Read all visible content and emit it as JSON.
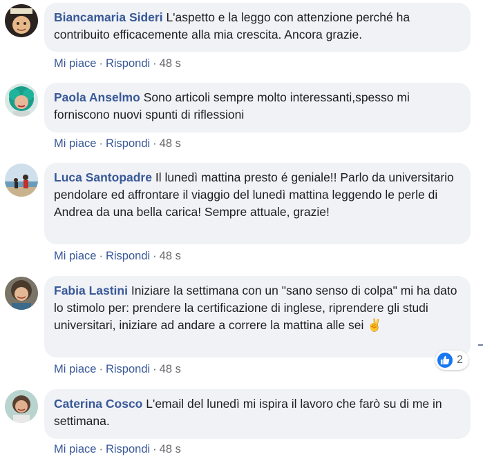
{
  "comments": [
    {
      "author": "Biancamaria Sideri",
      "text": "L'aspetto e la leggo con attenzione perché ha contribuito efficacemente alla mia crescita. Ancora grazie.",
      "like": "Mi piace",
      "reply": "Rispondi",
      "time": "48 s"
    },
    {
      "author": "Paola Anselmo",
      "text": "Sono articoli sempre molto interessanti,spesso mi forniscono nuovi spunti di riflessioni",
      "like": "Mi piace",
      "reply": "Rispondi",
      "time": "48 s"
    },
    {
      "author": "Luca Santopadre",
      "text": "Il lunedì mattina presto é geniale!! Parlo da universitario pendolare ed affrontare il viaggio del lunedì mattina leggendo le perle di Andrea da una bella carica! Sempre attuale, grazie!",
      "like": "Mi piace",
      "reply": "Rispondi",
      "time": "48 s"
    },
    {
      "author": "Fabia Lastini",
      "text": "Iniziare la settimana con un \"sano senso di colpa\" mi ha dato lo stimolo per: prendere la certificazione di inglese, riprendere gli studi universitari, iniziare ad andare a correre la mattina alle sei ✌️",
      "like": "Mi piace",
      "reply": "Rispondi",
      "time": "48 s",
      "reaction_count": "2",
      "reaction_icon": "like-thumb-icon"
    },
    {
      "author": "Caterina Cosco",
      "text": "L'email del lunedì mi ispira il lavoro che farò su di me in settimana.",
      "like": "Mi piace",
      "reply": "Rispondi",
      "time": "48 s"
    }
  ],
  "separator": "·",
  "colors": {
    "bubble": "#f0f2f5",
    "author": "#385898",
    "link": "#385898",
    "meta": "#65676b",
    "like_blue": "#1877f2"
  }
}
